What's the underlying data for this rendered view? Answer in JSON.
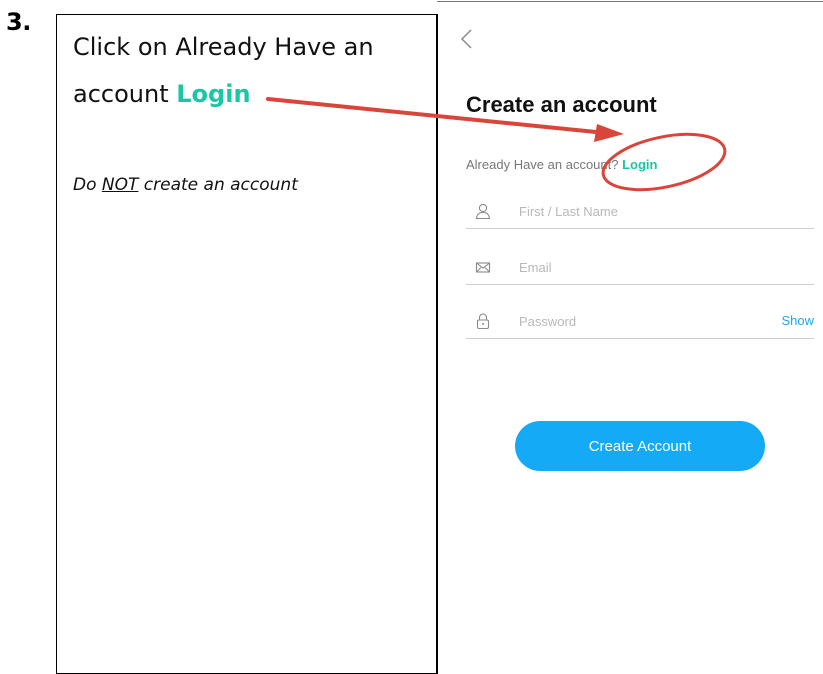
{
  "step": {
    "number": "3."
  },
  "instruction": {
    "line1": "Click on Already Have an",
    "line2_prefix": "account ",
    "line2_login": "Login",
    "warning_prefix": "Do ",
    "warning_emphasis": "NOT",
    "warning_suffix": " create an account"
  },
  "app": {
    "back_icon": "chevron-left-icon",
    "title": "Create an account",
    "already_text": "Already Have an account? ",
    "login_link": "Login",
    "fields": {
      "name": {
        "icon": "person-icon",
        "placeholder": "First / Last Name",
        "value": ""
      },
      "email": {
        "icon": "envelope-icon",
        "placeholder": "Email",
        "value": ""
      },
      "password": {
        "icon": "lock-icon",
        "placeholder": "Password",
        "value": "",
        "show_label": "Show"
      }
    },
    "create_button": "Create Account"
  },
  "colors": {
    "accent_green": "#1cc6a4",
    "accent_blue": "#14aaf5",
    "annotation_red": "#d9453b"
  }
}
